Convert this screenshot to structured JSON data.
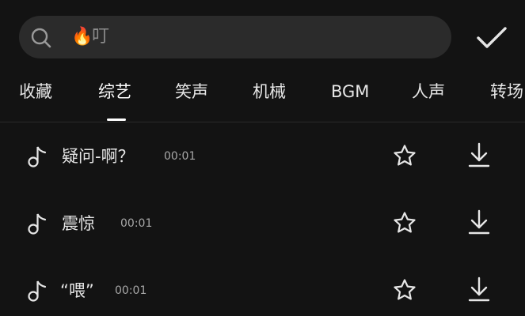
{
  "search": {
    "fire_emoji": "🔥",
    "query": "叮"
  },
  "tabs": [
    {
      "label": "收藏"
    },
    {
      "label": "综艺"
    },
    {
      "label": "笑声"
    },
    {
      "label": "机械"
    },
    {
      "label": "BGM"
    },
    {
      "label": "人声"
    },
    {
      "label": "转场"
    }
  ],
  "active_tab": "综艺",
  "sounds": [
    {
      "title": "疑问-啊？",
      "duration": "00:01"
    },
    {
      "title": "震惊",
      "duration": "00:01"
    },
    {
      "title": "“喂”",
      "duration": "00:01"
    }
  ],
  "icons": {
    "search": "search-icon",
    "confirm": "checkmark-icon",
    "note": "music-note-icon",
    "favorite": "star-icon",
    "download": "download-icon"
  },
  "colors": {
    "background": "#131313",
    "search_bg": "#2b2b2b",
    "text_primary": "#e6e6e6",
    "text_secondary": "#a8a8a8",
    "fire": "#e87a1f"
  }
}
